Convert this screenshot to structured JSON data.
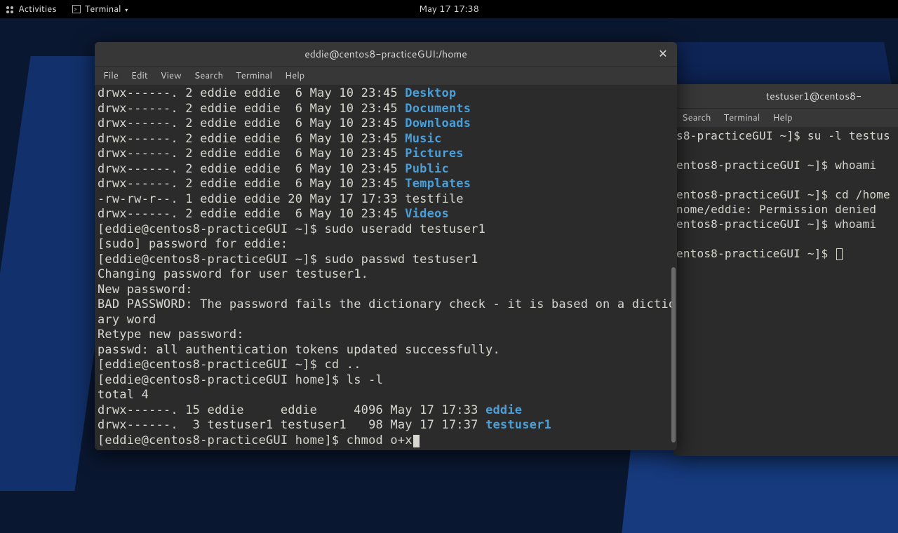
{
  "topbar": {
    "activities": "Activities",
    "app": "Terminal",
    "clock": "May 17  17:38"
  },
  "term1": {
    "title": "eddie@centos8-practiceGUI:/home",
    "menu": {
      "file": "File",
      "edit": "Edit",
      "view": "View",
      "search": "Search",
      "terminal": "Terminal",
      "help": "Help"
    },
    "ls_prefix": "drwx------. 2 eddie eddie  6 May 10 23:45 ",
    "dirs": [
      "Desktop",
      "Documents",
      "Downloads",
      "Music",
      "Pictures",
      "Public",
      "Templates"
    ],
    "testfile_line": "-rw-rw-r--. 1 eddie eddie 20 May 17 17:33 testfile",
    "videos_prefix": "drwx------. 2 eddie eddie  6 May 10 23:45 ",
    "videos": "Videos",
    "l01": "[eddie@centos8-practiceGUI ~]$ sudo useradd testuser1",
    "l02": "[sudo] password for eddie:",
    "l03": "[eddie@centos8-practiceGUI ~]$ sudo passwd testuser1",
    "l04": "Changing password for user testuser1.",
    "l05": "New password:",
    "l06": "BAD PASSWORD: The password fails the dictionary check - it is based on a diction",
    "l06b": "ary word",
    "l07": "Retype new password:",
    "l08": "passwd: all authentication tokens updated successfully.",
    "l09": "[eddie@centos8-practiceGUI ~]$ cd ..",
    "l10": "[eddie@centos8-practiceGUI home]$ ls -l",
    "l11": "total 4",
    "l12a": "drwx------. 15 eddie     eddie     4096 May 17 17:33 ",
    "l12b": "eddie",
    "l13a": "drwx------.  3 testuser1 testuser1   98 May 17 17:37 ",
    "l13b": "testuser1",
    "l14": "[eddie@centos8-practiceGUI home]$ chmod o+x"
  },
  "term2": {
    "title": "testuser1@centos8-",
    "menu": {
      "search": "Search",
      "terminal": "Terminal",
      "help": "Help"
    },
    "l1": "s8-practiceGUI ~]$ su -l testus",
    "sp": "",
    "l2": "entos8-practiceGUI ~]$ whoami",
    "l3": "entos8-practiceGUI ~]$ cd /home",
    "l4": "nome/eddie: Permission denied",
    "l5": "entos8-practiceGUI ~]$ whoami",
    "l6": "entos8-practiceGUI ~]$ "
  }
}
